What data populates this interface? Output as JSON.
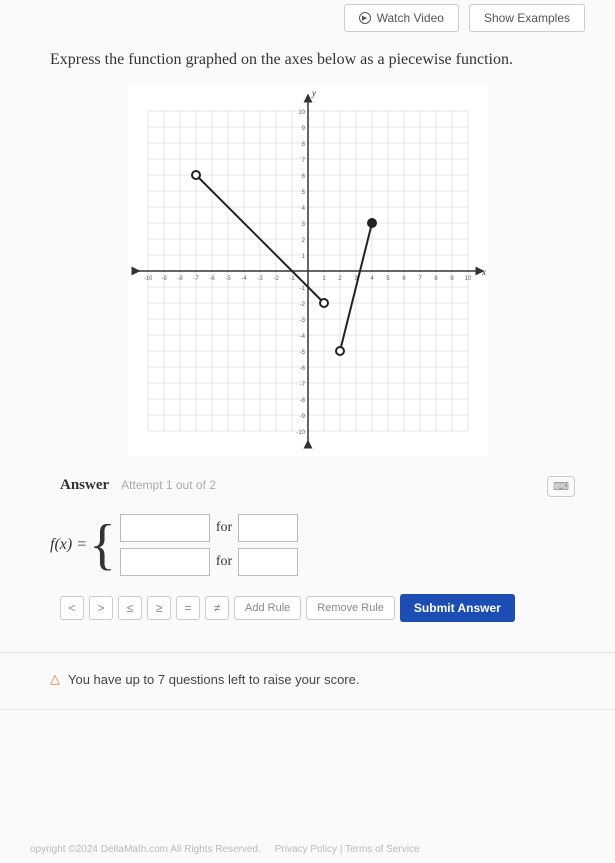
{
  "header": {
    "watch_video": "Watch Video",
    "show_examples": "Show Examples"
  },
  "question": "Express the function graphed on the axes below as a piecewise function.",
  "chart_data": {
    "type": "line",
    "title": "",
    "xlabel": "x",
    "ylabel": "y",
    "xlim": [
      -10,
      10
    ],
    "ylim": [
      -10,
      10
    ],
    "series": [
      {
        "name": "segment-1",
        "points": [
          {
            "x": -7,
            "y": 6,
            "endpoint": "open"
          },
          {
            "x": 1,
            "y": -2,
            "endpoint": "open"
          }
        ]
      },
      {
        "name": "segment-2",
        "points": [
          {
            "x": 2,
            "y": -5,
            "endpoint": "open"
          },
          {
            "x": 4,
            "y": 3,
            "endpoint": "closed"
          }
        ]
      }
    ],
    "xticks": [
      -10,
      -9,
      -8,
      -7,
      -6,
      -5,
      -4,
      -3,
      -2,
      -1,
      1,
      2,
      3,
      4,
      5,
      6,
      7,
      8,
      9,
      10
    ],
    "yticks": [
      -10,
      -9,
      -8,
      -7,
      -6,
      -5,
      -4,
      -3,
      -2,
      -1,
      1,
      2,
      3,
      4,
      5,
      6,
      7,
      8,
      9,
      10
    ]
  },
  "answer": {
    "label": "Answer",
    "attempt": "Attempt 1 out of 2",
    "fx": "f(x) =",
    "for": "for",
    "rules": [
      {
        "expr": "",
        "cond": ""
      },
      {
        "expr": "",
        "cond": ""
      }
    ]
  },
  "symbols": {
    "lt": "<",
    "gt": ">",
    "le": "≤",
    "ge": "≥",
    "eq": "=",
    "ne": "≠"
  },
  "buttons": {
    "add_rule": "Add Rule",
    "remove_rule": "Remove Rule",
    "submit": "Submit Answer"
  },
  "raise_score": "You have up to 7 questions left to raise your score.",
  "footer": {
    "copyright": "opyright ©2024 DeltaMath.com All Rights Reserved.",
    "privacy": "Privacy Policy",
    "sep": "|",
    "terms": "Terms of Service"
  }
}
